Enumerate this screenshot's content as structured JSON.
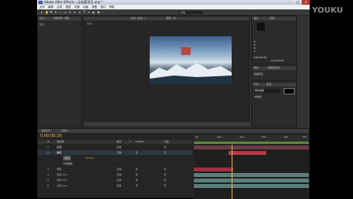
{
  "window": {
    "title": "Adobe After Effects - 无标题项目.aep *",
    "logo_text": "Ae",
    "btn_min": "–",
    "btn_max": "□",
    "btn_close": "✕"
  },
  "menu": [
    "文件",
    "编辑",
    "合成",
    "图层",
    "效果",
    "动画",
    "视图",
    "窗口",
    "帮助"
  ],
  "toolbar": {
    "tools": [
      "▸",
      "✋",
      "🔍",
      "↻",
      "⬚",
      "▭",
      "✎",
      "⌖",
      "✦",
      "T",
      "✒",
      "◐",
      "✱"
    ],
    "workspace": "标准"
  },
  "project": {
    "tabs": [
      "项目 ×",
      "效果控件: 图层"
    ],
    "label": "图层"
  },
  "comp_viewer": {
    "tabs": [
      "合成: 合成1 ×",
      "图层: (无)"
    ],
    "comp_label": "合成1"
  },
  "right_panel": {
    "info_tab": "信息",
    "audio_tab": "音频",
    "preview_tab": "预览",
    "effects_tab": "效果和预设",
    "character_tab": "字符",
    "paragraph_tab": "段落",
    "info_values": [
      "R:",
      "G:",
      "B:",
      "A:"
    ],
    "effects_label": "动画预设",
    "char_font": "微软雅黑",
    "char_size": "36像素",
    "timecode_a": "0;00;00;19",
    "timecode_b": "0;00;00;21"
  },
  "timeline": {
    "tabs": [
      "渲染队列",
      "合成1 ×"
    ],
    "timecode": "0;00;00;26",
    "col_headers": [
      "#",
      "源名称",
      "模式",
      "T",
      "TrkMat",
      "父级"
    ],
    "rows": [
      {
        "num": "1",
        "name": "标题",
        "mode": "正常",
        "trk": "",
        "parent": "无"
      },
      {
        "num": "2",
        "name": "静音",
        "mode": "正常",
        "trk": "无",
        "parent": "无"
      },
      {
        "num": "",
        "name": "缩放",
        "mode": "",
        "trk": "",
        "parent": ""
      },
      {
        "num": "",
        "name": "不透明度",
        "mode": "",
        "trk": "",
        "parent": ""
      },
      {
        "num": "3",
        "name": "纯色",
        "mode": "正常",
        "trk": "无",
        "parent": "无"
      },
      {
        "num": "4",
        "name": "遮罩.mov",
        "mode": "正常",
        "trk": "无",
        "parent": "无"
      },
      {
        "num": "5",
        "name": "背景.mov",
        "mode": "正常",
        "trk": "无",
        "parent": "无"
      },
      {
        "num": "6",
        "name": "山景.mov",
        "mode": "正常",
        "trk": "无",
        "parent": "无"
      }
    ],
    "prop_value": "100,0%",
    "ruler": [
      "0s",
      "01s",
      "02s",
      "03s",
      "04s",
      "05s"
    ]
  },
  "watermark": "YOUKU"
}
